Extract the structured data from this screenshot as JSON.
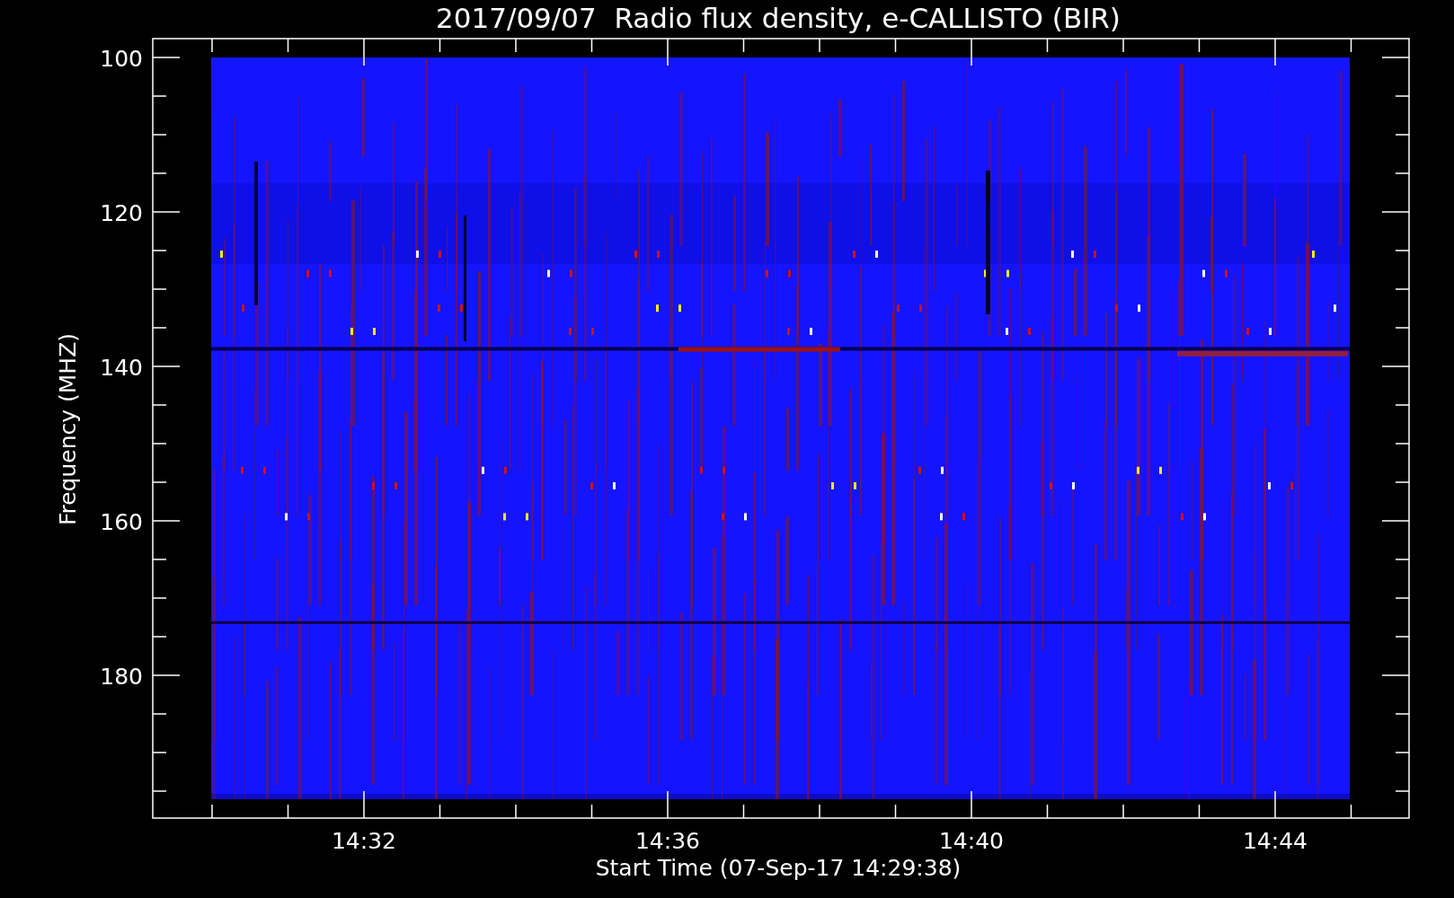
{
  "title": "2017/09/07  Radio flux density, e-CALLISTO (BIR)",
  "y_axis": {
    "label": "Frequency (MHZ)",
    "ticks": [
      "100",
      "120",
      "140",
      "160",
      "180"
    ]
  },
  "x_axis": {
    "label": "Start Time (07-Sep-17 14:29:38)",
    "ticks": [
      "14:32",
      "14:36",
      "14:40",
      "14:44"
    ]
  }
}
